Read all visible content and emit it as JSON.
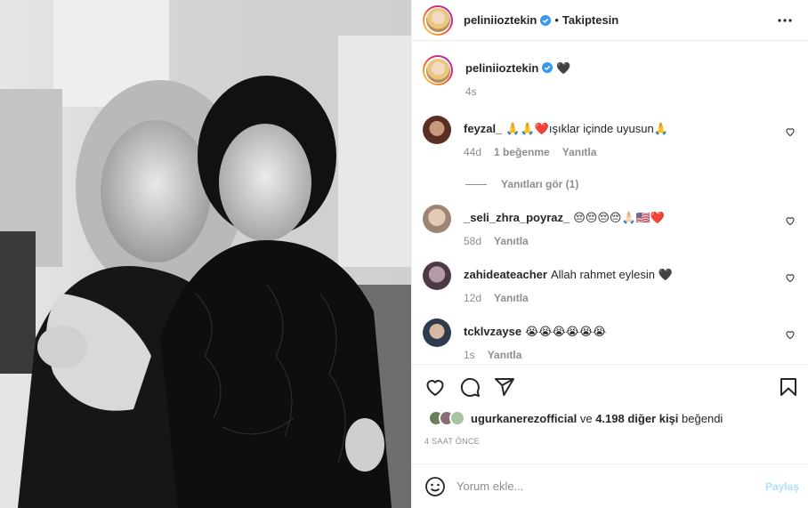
{
  "header": {
    "username": "peliniioztekin",
    "separator": "•",
    "follow_label": "Takiptesin"
  },
  "caption": {
    "username": "peliniioztekin",
    "text": "🖤",
    "age": "4s"
  },
  "comments": [
    {
      "username": "feyzal_",
      "text": "🙏🙏❤️ışıklar içinde uyusun🙏",
      "age": "44d",
      "likes": "1 beğenme",
      "reply": "Yanıtla",
      "view_replies": "Yanıtları gör (1)"
    },
    {
      "username": "_seli_zhra_poyraz_",
      "text": "😔😔😔😔🙏🏻🇺🇸❤️",
      "age": "58d",
      "reply": "Yanıtla"
    },
    {
      "username": "zahideateacher",
      "text": "Allah rahmet eylesin 🖤",
      "age": "12d",
      "reply": "Yanıtla"
    },
    {
      "username": "tcklvzayse",
      "text": "😭😭😭😭😭😭",
      "age": "1s",
      "reply": "Yanıtla"
    }
  ],
  "likes": {
    "first_liker": "ugurkanerezofficial",
    "connector": "ve",
    "others": "4.198 diğer kişi",
    "suffix": "beğendi"
  },
  "timestamp": "4 SAAT ÖNCE",
  "composer": {
    "placeholder": "Yorum ekle...",
    "post_label": "Paylaş"
  },
  "icons": {
    "verified": "verified-badge-icon",
    "more": "more-options-icon",
    "like": "heart-icon",
    "comment": "comment-icon",
    "share": "share-icon",
    "save": "bookmark-icon",
    "emoji": "emoji-icon"
  },
  "colors": {
    "verified_blue": "#3897f0",
    "post_button": "#b2dffc",
    "muted_text": "#8e8e8e"
  }
}
